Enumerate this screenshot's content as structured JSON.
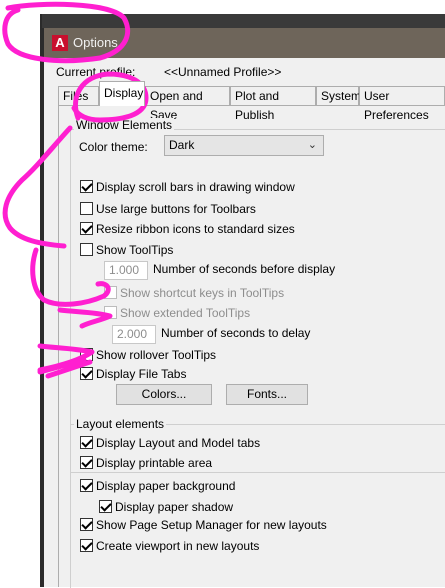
{
  "window": {
    "title": "Options"
  },
  "profile": {
    "label": "Current profile:",
    "value": "<<Unnamed Profile>>"
  },
  "tabs": [
    {
      "label": "Files"
    },
    {
      "label": "Display",
      "active": true
    },
    {
      "label": "Open and Save"
    },
    {
      "label": "Plot and Publish"
    },
    {
      "label": "System"
    },
    {
      "label": "User Preferences"
    }
  ],
  "window_elements": {
    "group_label": "Window Elements",
    "color_theme_label": "Color theme:",
    "color_theme_value": "Dark",
    "options": [
      {
        "label": "Display scroll bars in drawing window",
        "checked": true,
        "enabled": true
      },
      {
        "label": "Use large buttons for Toolbars",
        "checked": false,
        "enabled": true
      },
      {
        "label": "Resize ribbon icons to standard sizes",
        "checked": true,
        "enabled": true
      },
      {
        "label": "Show ToolTips",
        "checked": false,
        "enabled": true
      },
      {
        "label": "Show shortcut keys in ToolTips",
        "checked": false,
        "enabled": false
      },
      {
        "label": "Show extended ToolTips",
        "checked": false,
        "enabled": false
      },
      {
        "label": "Show rollover ToolTips",
        "checked": false,
        "enabled": true
      },
      {
        "label": "Display File Tabs",
        "checked": true,
        "enabled": true
      }
    ],
    "tooltip_delay": {
      "value": "1.000",
      "label": "Number of seconds before display"
    },
    "extended_delay": {
      "value": "2.000",
      "label": "Number of seconds to delay"
    },
    "colors_button": "Colors...",
    "fonts_button": "Fonts..."
  },
  "layout_elements": {
    "group_label": "Layout elements",
    "options": [
      {
        "label": "Display Layout and Model tabs",
        "checked": true
      },
      {
        "label": "Display printable area",
        "checked": true
      },
      {
        "label": "Display paper background",
        "checked": true
      },
      {
        "label": "Display paper shadow",
        "checked": true
      },
      {
        "label": "Show Page Setup Manager for new layouts",
        "checked": true
      },
      {
        "label": "Create viewport in new layouts",
        "checked": true
      }
    ]
  },
  "annotation": {
    "color": "#ff1fd0"
  }
}
